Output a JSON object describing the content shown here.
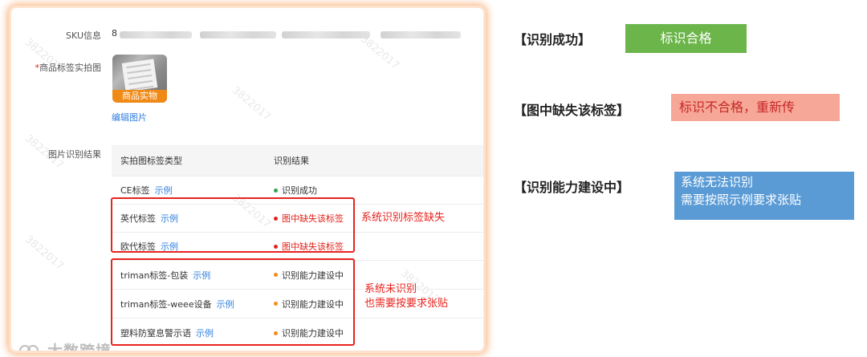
{
  "form": {
    "sku_label": "SKU信息",
    "sku_value_lead": "8",
    "photo_label_req": "*",
    "photo_label": "商品标签实拍图",
    "thumb_tag": "商品实物",
    "edit_image": "编辑图片",
    "result_label": "图片识别结果"
  },
  "table": {
    "headers": [
      "实拍图标签类型",
      "识别结果"
    ],
    "example_link": "示例",
    "rows": [
      {
        "type": "CE标签",
        "result": "识别成功",
        "status": "ok"
      },
      {
        "type": "英代标签",
        "result": "图中缺失该标签",
        "status": "miss"
      },
      {
        "type": "欧代标签",
        "result": "图中缺失该标签",
        "status": "miss"
      },
      {
        "type": "triman标签-包装",
        "result": "识别能力建设中",
        "status": "build"
      },
      {
        "type": "triman标签-weee设备",
        "result": "识别能力建设中",
        "status": "build"
      },
      {
        "type": "塑料防窒息警示语",
        "result": "识别能力建设中",
        "status": "build"
      }
    ]
  },
  "annotations": {
    "missing": "系统识别标签缺失",
    "unrecognized_line1": "系统未识别",
    "unrecognized_line2": "也需要按要求张贴"
  },
  "watermark": "3822017",
  "brand": "大数跨境",
  "legend": {
    "success_label": "【识别成功】",
    "success_chip": "标识合格",
    "missing_label": "【图中缺失该标签】",
    "missing_chip": "标识不合格，重新传",
    "building_label": "【识别能力建设中】",
    "building_chip_line1": "系统无法识别",
    "building_chip_line2": "需要按照示例要求张贴"
  },
  "colors": {
    "ok_dot": "#2ea44f",
    "miss_dot": "#e2231a",
    "build_dot": "#f28c1b",
    "highlight_red": "#e8231e",
    "link_blue": "#2f7fe0"
  }
}
